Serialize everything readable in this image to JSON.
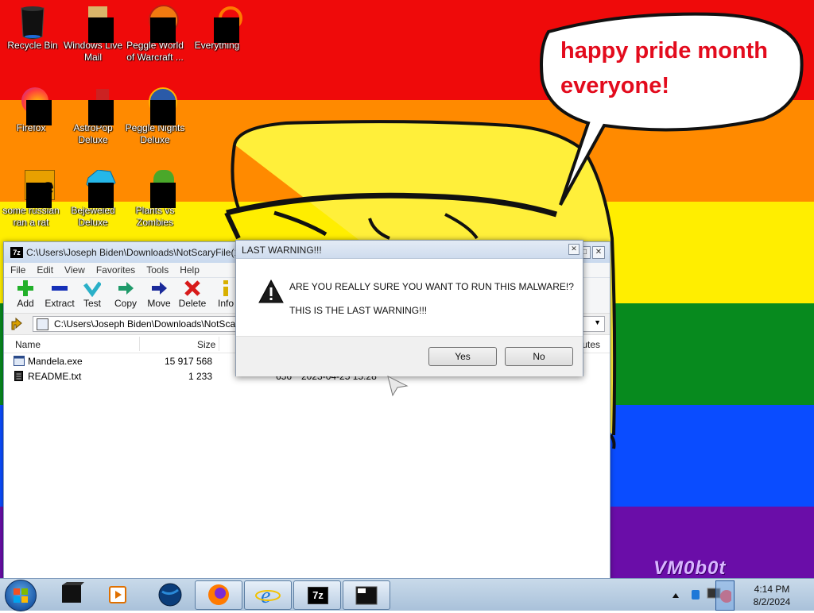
{
  "wallpaper": {
    "stripe_colors": [
      "#ef0a0a",
      "#ff8a00",
      "#ffee00",
      "#078a1e",
      "#0a4cff",
      "#6a0da8"
    ],
    "speech_bubble_text": "happy pride month everyone!",
    "watermark": "VM0b0t"
  },
  "desktop_icons": [
    {
      "label": "Recycle Bin",
      "icon": "recycle-bin-icon"
    },
    {
      "label": "Windows Live Mail",
      "icon": "mail-icon"
    },
    {
      "label": "Peggle World of Warcraft ...",
      "icon": "game-icon"
    },
    {
      "label": "Everything",
      "icon": "search-icon"
    },
    {
      "label": "Firefox",
      "icon": "firefox-icon"
    },
    {
      "label": "AstroPop Deluxe",
      "icon": "game-icon"
    },
    {
      "label": "Peggle Nights Deluxe",
      "icon": "game-icon"
    },
    {
      "label": "some russian ran a rat",
      "icon": "ie-icon"
    },
    {
      "label": "Bejeweled Deluxe",
      "icon": "gem-icon"
    },
    {
      "label": "Plants vs Zombies",
      "icon": "plant-icon"
    }
  ],
  "zip_window": {
    "title": "C:\\Users\\Joseph Biden\\Downloads\\NotScaryFile(1",
    "app_icon_text": "7z",
    "menu": [
      "File",
      "Edit",
      "View",
      "Favorites",
      "Tools",
      "Help"
    ],
    "toolbar": [
      {
        "label": "Add",
        "icon": "plus-icon",
        "color": "#22b02a"
      },
      {
        "label": "Extract",
        "icon": "minus-icon",
        "color": "#1530b8"
      },
      {
        "label": "Test",
        "icon": "check-icon",
        "color": "#2ab0c8"
      },
      {
        "label": "Copy",
        "icon": "copy-arrow-icon",
        "color": "#1f9a6a"
      },
      {
        "label": "Move",
        "icon": "move-arrow-icon",
        "color": "#1a2a9a"
      },
      {
        "label": "Delete",
        "icon": "delete-x-icon",
        "color": "#d81a1a"
      },
      {
        "label": "Info",
        "icon": "info-icon",
        "color": "#d8b000"
      }
    ],
    "address": "C:\\Users\\Joseph Biden\\Downloads\\NotScar",
    "columns": {
      "name": "Name",
      "size": "Size",
      "attributes": "ributes"
    },
    "files": [
      {
        "name": "Mandela.exe",
        "size": "15 917 568",
        "packed": "",
        "modified": ""
      },
      {
        "name": "README.txt",
        "size": "1 233",
        "packed": "656",
        "modified": "2023-04-25 15:28"
      }
    ]
  },
  "dialog": {
    "title": "LAST WARNING!!!",
    "message": "ARE YOU REALLY SURE YOU WANT TO RUN THIS MALWARE!?",
    "submessage": "THIS IS THE LAST WARNING!!!",
    "yes_label": "Yes",
    "no_label": "No"
  },
  "taskbar": {
    "time": "4:14 PM",
    "date": "8/2/2024",
    "pinned": [
      "terminal-icon",
      "media-player-icon",
      "globe-icon",
      "firefox-icon",
      "ie-icon",
      "7zip-icon",
      "window-icon"
    ],
    "seven_zip_label": "7z"
  }
}
